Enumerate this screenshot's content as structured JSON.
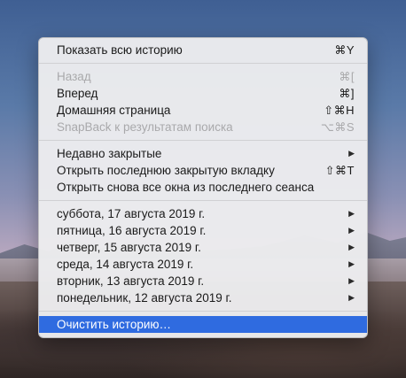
{
  "menu": {
    "group1": [
      {
        "label": "Показать всю историю",
        "shortcut": "⌘Y"
      }
    ],
    "group2": [
      {
        "label": "Назад",
        "shortcut": "⌘[",
        "disabled": true
      },
      {
        "label": "Вперед",
        "shortcut": "⌘]"
      },
      {
        "label": "Домашняя страница",
        "shortcut": "⇧⌘H"
      },
      {
        "label": "SnapBack к результатам поиска",
        "shortcut": "⌥⌘S",
        "disabled": true
      }
    ],
    "group3": [
      {
        "label": "Недавно закрытые",
        "arrow": "▶"
      },
      {
        "label": "Открыть последнюю закрытую вкладку",
        "shortcut": "⇧⌘T"
      },
      {
        "label": "Открыть снова все окна из последнего сеанса"
      }
    ],
    "history_days": [
      {
        "label": "суббота, 17 августа 2019 г.",
        "arrow": "▶"
      },
      {
        "label": "пятница, 16 августа 2019 г.",
        "arrow": "▶"
      },
      {
        "label": "четверг, 15 августа 2019 г.",
        "arrow": "▶"
      },
      {
        "label": "среда, 14 августа 2019 г.",
        "arrow": "▶"
      },
      {
        "label": "вторник, 13 августа 2019 г.",
        "arrow": "▶"
      },
      {
        "label": "понедельник, 12 августа 2019 г.",
        "arrow": "▶"
      }
    ],
    "clear_history": {
      "label": "Очистить историю…"
    }
  }
}
